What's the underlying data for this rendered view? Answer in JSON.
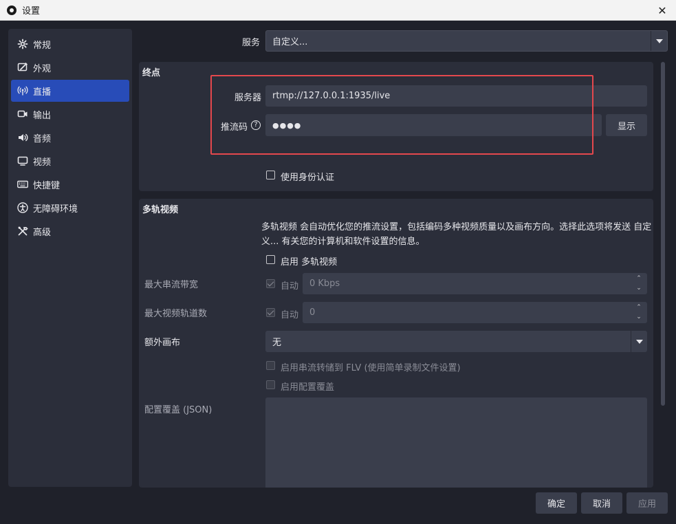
{
  "window": {
    "title": "设置",
    "close_symbol": "✕"
  },
  "sidebar": {
    "items": [
      {
        "label": "常规",
        "icon": "gear-icon"
      },
      {
        "label": "外观",
        "icon": "appearance-icon"
      },
      {
        "label": "直播",
        "icon": "broadcast-icon",
        "active": true
      },
      {
        "label": "输出",
        "icon": "output-icon"
      },
      {
        "label": "音频",
        "icon": "speaker-icon"
      },
      {
        "label": "视频",
        "icon": "monitor-icon"
      },
      {
        "label": "快捷键",
        "icon": "keyboard-icon"
      },
      {
        "label": "无障碍环境",
        "icon": "accessibility-icon"
      },
      {
        "label": "高级",
        "icon": "tools-icon"
      }
    ]
  },
  "service": {
    "label": "服务",
    "value": "自定义..."
  },
  "endpoint": {
    "title": "终点",
    "server_label": "服务器",
    "server_value": "rtmp://127.0.0.1:1935/live",
    "streamkey_label": "推流码",
    "help_symbol": "?",
    "streamkey_value": "●●●●",
    "show_button": "显示",
    "auth_label": "使用身份认证"
  },
  "multitrack": {
    "title": "多轨视频",
    "description": "多轨视频 会自动优化您的推流设置，包括编码多种视频质量以及画布方向。选择此选项将发送 自定义... 有关您的计算机和软件设置的信息。",
    "enable_label": "启用 多轨视频",
    "max_bitrate_label": "最大串流带宽",
    "auto_label": "自动",
    "max_bitrate_value": "0 Kbps",
    "max_tracks_label": "最大视频轨道数",
    "max_tracks_value": "0",
    "extra_canvas_label": "额外画布",
    "extra_canvas_value": "无",
    "flv_label": "启用串流转储到 FLV (使用简单录制文件设置)",
    "config_override_label": "启用配置覆盖",
    "config_json_label": "配置覆盖 (JSON)",
    "spin_up": "⌃",
    "spin_down": "⌄"
  },
  "footer": {
    "ok": "确定",
    "cancel": "取消",
    "apply": "应用"
  },
  "colors": {
    "accent": "#284cb8",
    "highlight": "#e5484d",
    "panel": "#2b2e3a",
    "field": "#3a3e4c"
  }
}
